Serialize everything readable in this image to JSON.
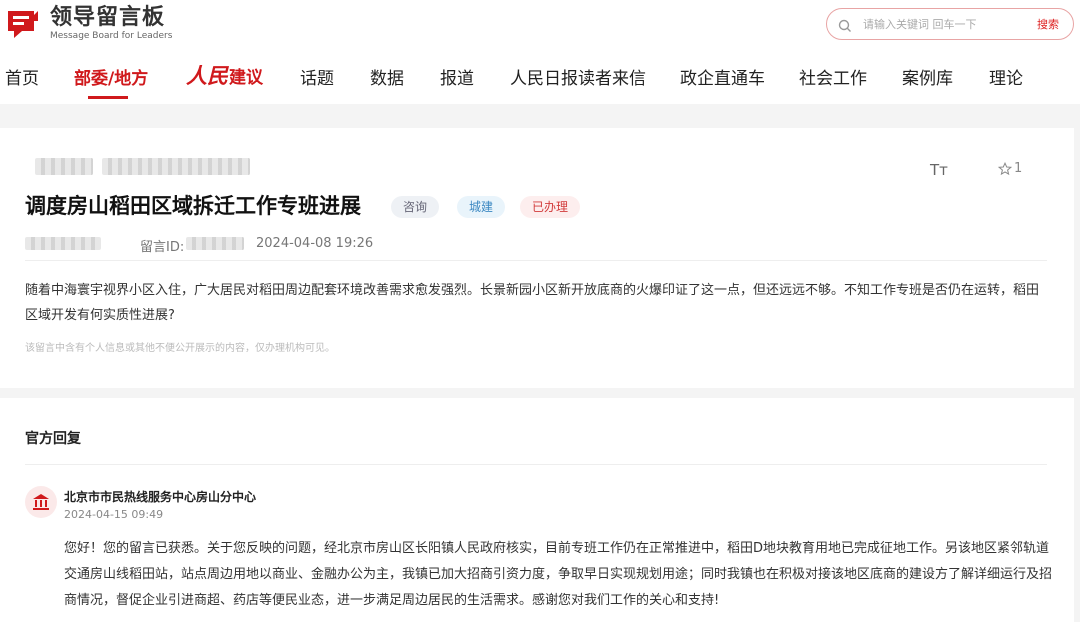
{
  "header": {
    "logo": {
      "cn": "领导留言板",
      "en": "Message Board for Leaders",
      "mark_icon": "messageboard-logo-icon",
      "brand_color": "#d0191c"
    },
    "search": {
      "placeholder": "请输入关键词 回车一下",
      "button_label": "搜索",
      "icon": "search-icon"
    }
  },
  "nav": {
    "items": [
      {
        "label": "首页"
      },
      {
        "label": "部委/地方",
        "active": true
      },
      {
        "label_brush": "人民",
        "label_word": "建议"
      },
      {
        "label": "话题"
      },
      {
        "label": "数据"
      },
      {
        "label": "报道"
      },
      {
        "label": "人民日报读者来信"
      },
      {
        "label": "政企直通车"
      },
      {
        "label": "社会工作"
      },
      {
        "label": "案例库"
      },
      {
        "label": "理论"
      }
    ]
  },
  "message": {
    "title": "调度房山稻田区域拆迁工作专班进展",
    "tags": [
      {
        "label": "咨询",
        "color": "#667"
      },
      {
        "label": "城建",
        "color": "#3b88c2"
      },
      {
        "label": "已办理",
        "color": "#d23c3c"
      }
    ],
    "id_label": "留言ID:",
    "datetime": "2024-04-08 19:26",
    "font_toggle": "Tт",
    "favorite_count": "1",
    "content": "随着中海寰宇视界小区入住，广大居民对稻田周边配套环境改善需求愈发强烈。长景新园小区新开放底商的火爆印证了这一点，但还远远不够。不知工作专班是否仍在运转，稻田区域开发有何实质性进展?",
    "privacy_notice": "该留言中含有个人信息或其他不便公开展示的内容，仅办理机构可见。"
  },
  "reply": {
    "heading": "官方回复",
    "org": "北京市市民热线服务中心房山分中心",
    "datetime": "2024-04-15 09:49",
    "avatar_icon": "government-building-icon",
    "text": "您好！您的留言已获悉。关于您反映的问题，经北京市房山区长阳镇人民政府核实，目前专班工作仍在正常推进中，稻田D地块教育用地已完成征地工作。另该地区紧邻轨道交通房山线稻田站，站点周边用地以商业、金融办公为主，我镇已加大招商引资力度，争取早日实现规划用途；同时我镇也在积极对接该地区底商的建设方了解详细运行及招商情况，督促企业引进商超、药店等便民业态，进一步满足周边居民的生活需求。感谢您对我们工作的关心和支持!"
  }
}
